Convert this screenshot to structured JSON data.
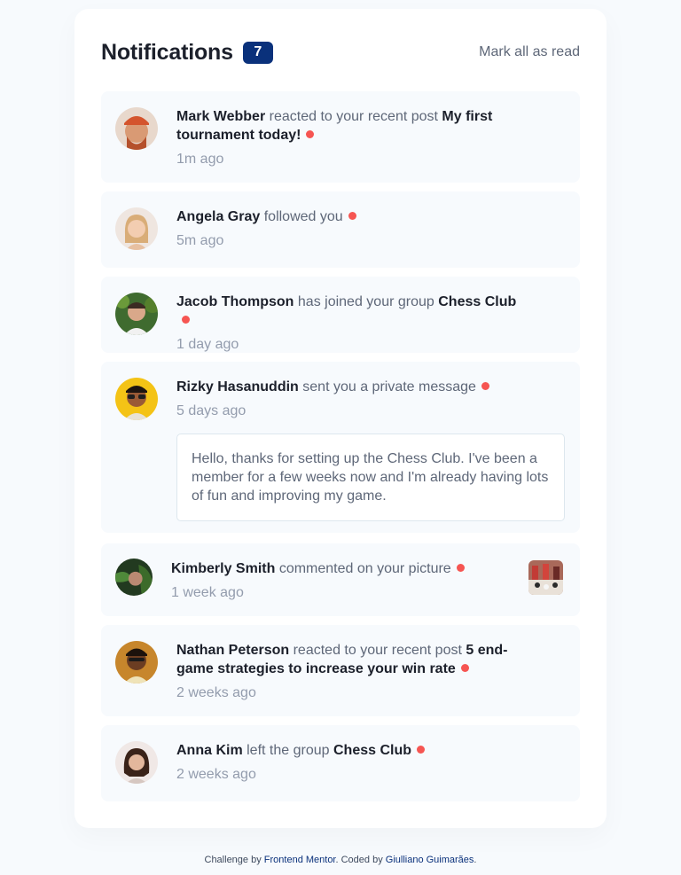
{
  "header": {
    "title": "Notifications",
    "unread_count": "7",
    "mark_all_label": "Mark all as read"
  },
  "notifications": [
    {
      "actor": "Mark Webber",
      "action": "reacted to your recent post",
      "target": "My first tournament today!",
      "time": "1m ago",
      "unread": true,
      "avatar_color": "#d8b49a"
    },
    {
      "actor": "Angela Gray",
      "action": "followed you",
      "target": "",
      "time": "5m ago",
      "unread": true,
      "avatar_color": "#e9c7a8"
    },
    {
      "actor": "Jacob Thompson",
      "action": "has joined your group",
      "target": "Chess Club",
      "time": "1 day ago",
      "unread": true,
      "avatar_color": "#4e7a3a"
    },
    {
      "actor": "Rizky Hasanuddin",
      "action": "sent you a private message",
      "target": "",
      "time": "5 days ago",
      "unread": true,
      "message": "Hello, thanks for setting up the Chess Club. I've been a member for a few weeks now and I'm already having lots of fun and improving my game.",
      "avatar_color": "#f4c316"
    },
    {
      "actor": "Kimberly Smith",
      "action": "commented on your picture",
      "target": "",
      "time": "1 week ago",
      "unread": true,
      "has_picture": true,
      "avatar_color": "#2f4a2c"
    },
    {
      "actor": "Nathan Peterson",
      "action": "reacted to your recent post",
      "target": "5 end-game strategies to increase your win rate",
      "time": "2 weeks ago",
      "unread": true,
      "avatar_color": "#c98a3a"
    },
    {
      "actor": "Anna Kim",
      "action": "left the group",
      "target": "Chess Club",
      "time": "2 weeks ago",
      "unread": true,
      "avatar_color": "#e7dcdc"
    }
  ],
  "footer": {
    "prefix": "Challenge by",
    "link1": "Frontend Mentor",
    "middle": ". Coded by",
    "link2": "Giulliano Guimarães",
    "suffix": "."
  },
  "colors": {
    "unread_dot": "#f65552",
    "badge": "#0a317b",
    "note_bg": "#f7fafd"
  }
}
